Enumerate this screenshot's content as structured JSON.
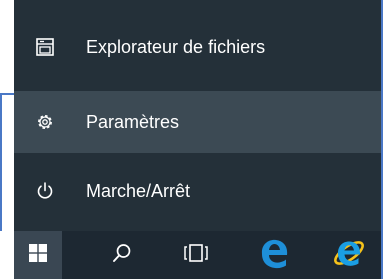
{
  "start_menu": {
    "items": [
      {
        "label": "Explorateur de fichiers",
        "icon": "file-explorer-icon"
      },
      {
        "label": "Paramètres",
        "icon": "gear-icon"
      },
      {
        "label": "Marche/Arrêt",
        "icon": "power-icon"
      }
    ],
    "highlighted_index": 1
  },
  "taskbar": {
    "icons": [
      "windows-start-icon",
      "search-icon",
      "task-view-icon",
      "edge-icon",
      "internet-explorer-icon"
    ]
  },
  "colors": {
    "menu_background": "#243039",
    "menu_highlight": "#3c4a54",
    "taskbar_background": "#1d2832",
    "start_button_background": "#3a4753",
    "edge_blue": "#1e8fd8",
    "ie_blue": "#1a9ee3",
    "ie_ring": "#f5c21b",
    "frame_border": "#4a78c6"
  }
}
